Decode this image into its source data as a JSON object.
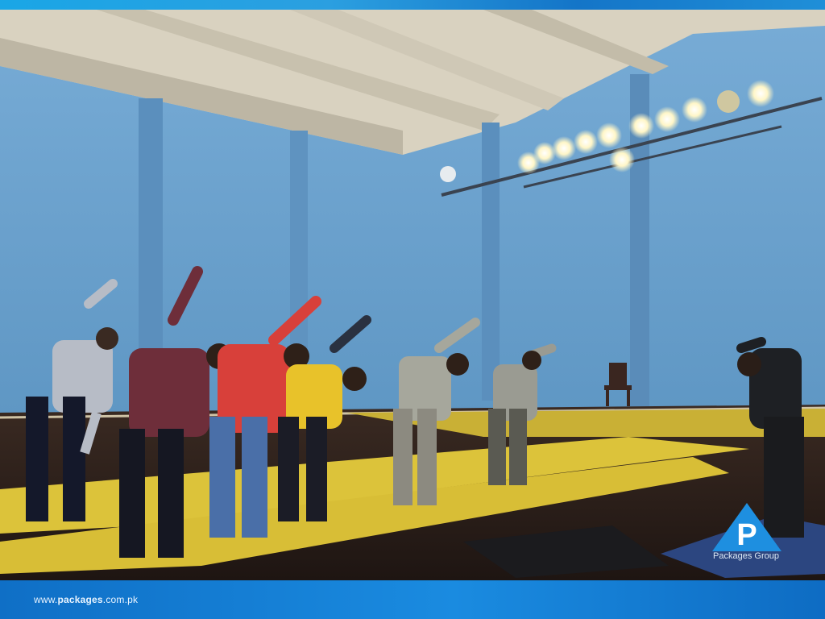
{
  "footer": {
    "url_prefix": "www.",
    "url_brand": "packages",
    "url_suffix": ".com.pk"
  },
  "logo": {
    "letter": "P",
    "caption": "Packages Group",
    "icon": "triangle-p-logo",
    "color": "#1e8fe0"
  },
  "colors": {
    "accent_blue": "#1a8be0",
    "mat_yellow": "#e0c93a",
    "wall_blue": "#6fa6d3"
  }
}
